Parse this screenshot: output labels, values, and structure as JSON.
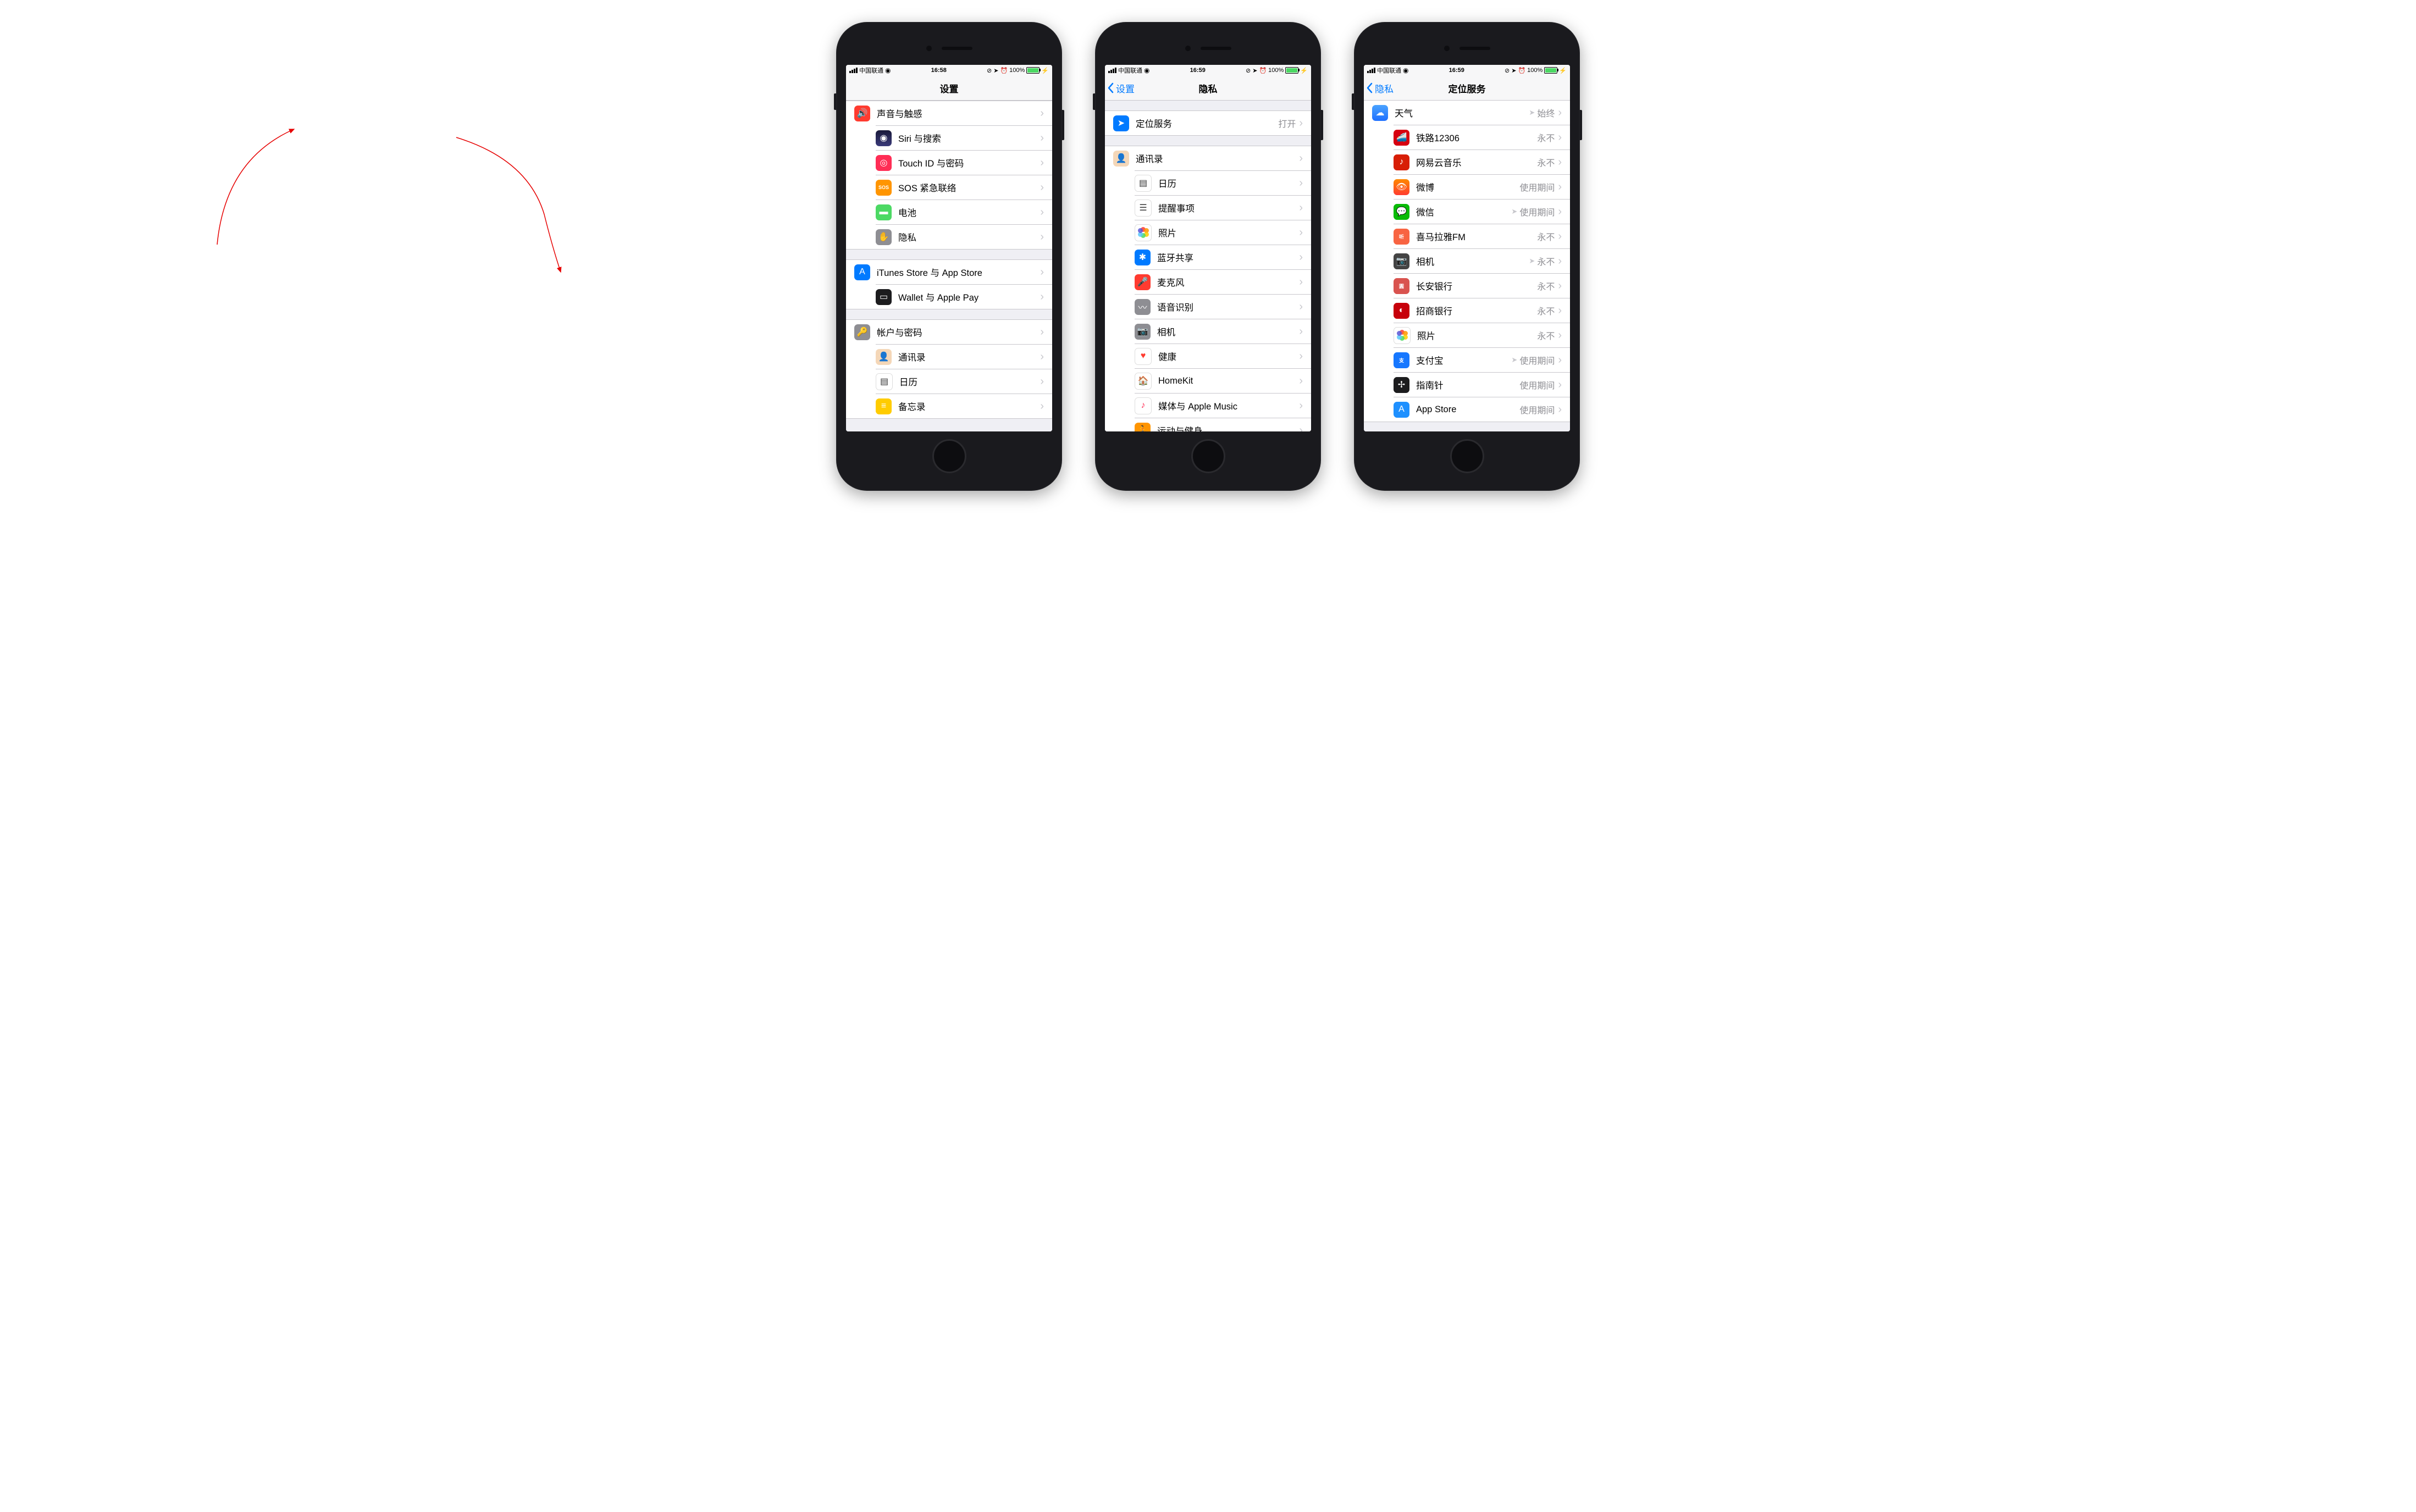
{
  "status": {
    "carrier": "中国联通",
    "time1": "16:58",
    "time2": "16:59",
    "time3": "16:59",
    "battery": "100%"
  },
  "screen1": {
    "title": "设置",
    "groups": [
      [
        {
          "label": "声音与触感",
          "icon": "ic-red",
          "glyph": "🔊"
        },
        {
          "label": "Siri 与搜索",
          "icon": "ic-darkblue",
          "glyph": "◉"
        },
        {
          "label": "Touch ID 与密码",
          "icon": "ic-pink",
          "glyph": "◎"
        },
        {
          "label": "SOS 紧急联络",
          "icon": "ic-orange",
          "glyph": "SOS",
          "small": true
        },
        {
          "label": "电池",
          "icon": "ic-green",
          "glyph": "▬"
        },
        {
          "label": "隐私",
          "icon": "ic-gray",
          "glyph": "✋"
        }
      ],
      [
        {
          "label": "iTunes Store 与 App Store",
          "icon": "ic-blue",
          "glyph": "A"
        },
        {
          "label": "Wallet 与 Apple Pay",
          "icon": "ic-black",
          "glyph": "▭"
        }
      ],
      [
        {
          "label": "帐户与密码",
          "icon": "ic-gray",
          "glyph": "🔑"
        },
        {
          "label": "通讯录",
          "icon": "ic-skin",
          "glyph": "👤"
        },
        {
          "label": "日历",
          "icon": "ic-white",
          "glyph": "▤"
        },
        {
          "label": "备忘录",
          "icon": "ic-yellow",
          "glyph": "≡"
        }
      ]
    ]
  },
  "screen2": {
    "back": "设置",
    "title": "隐私",
    "groups": [
      [
        {
          "label": "定位服务",
          "icon": "ic-blue",
          "glyph": "➤",
          "detail": "打开"
        }
      ],
      [
        {
          "label": "通讯录",
          "icon": "ic-skin",
          "glyph": "👤"
        },
        {
          "label": "日历",
          "icon": "ic-white",
          "glyph": "▤"
        },
        {
          "label": "提醒事项",
          "icon": "ic-white",
          "glyph": "☰"
        },
        {
          "label": "照片",
          "icon": "ic-photos",
          "photos": true
        },
        {
          "label": "蓝牙共享",
          "icon": "ic-blue",
          "glyph": "✱"
        },
        {
          "label": "麦克风",
          "icon": "ic-red",
          "glyph": "🎤"
        },
        {
          "label": "语音识别",
          "icon": "ic-gray",
          "glyph": "〰"
        },
        {
          "label": "相机",
          "icon": "ic-gray",
          "glyph": "📷"
        },
        {
          "label": "健康",
          "icon": "ic-white",
          "glyph": "♥",
          "heartRed": true
        },
        {
          "label": "HomeKit",
          "icon": "ic-white",
          "glyph": "🏠",
          "homeOrange": true
        },
        {
          "label": "媒体与 Apple Music",
          "icon": "ic-white",
          "glyph": "♪",
          "musicPink": true
        },
        {
          "label": "运动与健身",
          "icon": "ic-orange",
          "glyph": "🏃"
        }
      ]
    ]
  },
  "screen3": {
    "back": "隐私",
    "title": "定位服务",
    "items": [
      {
        "label": "天气",
        "icon": "ic-weather",
        "glyph": "☁",
        "detail": "始终",
        "arrow": true
      },
      {
        "label": "铁路12306",
        "icon": "ic-12306",
        "glyph": "🚄",
        "detail": "永不"
      },
      {
        "label": "网易云音乐",
        "icon": "ic-netease",
        "glyph": "♪",
        "detail": "永不"
      },
      {
        "label": "微博",
        "icon": "ic-weibo",
        "glyph": "👁",
        "detail": "使用期间"
      },
      {
        "label": "微信",
        "icon": "ic-wechat",
        "glyph": "💬",
        "detail": "使用期间",
        "arrow": true
      },
      {
        "label": "喜马拉雅FM",
        "icon": "ic-ximalaya",
        "glyph": "听",
        "small": true,
        "detail": "永不"
      },
      {
        "label": "相机",
        "icon": "ic-camera",
        "glyph": "📷",
        "detail": "永不",
        "arrow": true
      },
      {
        "label": "长安银行",
        "icon": "ic-cab",
        "glyph": "圓",
        "small": true,
        "detail": "永不"
      },
      {
        "label": "招商银行",
        "icon": "ic-cmb",
        "glyph": "◐",
        "detail": "永不"
      },
      {
        "label": "照片",
        "icon": "ic-photos",
        "photos": true,
        "detail": "永不"
      },
      {
        "label": "支付宝",
        "icon": "ic-alipay",
        "glyph": "支",
        "small": true,
        "detail": "使用期间",
        "arrow": true
      },
      {
        "label": "指南针",
        "icon": "ic-compass",
        "glyph": "✢",
        "detail": "使用期间"
      },
      {
        "label": "App Store",
        "icon": "ic-appstore",
        "glyph": "A",
        "detail": "使用期间"
      }
    ]
  }
}
